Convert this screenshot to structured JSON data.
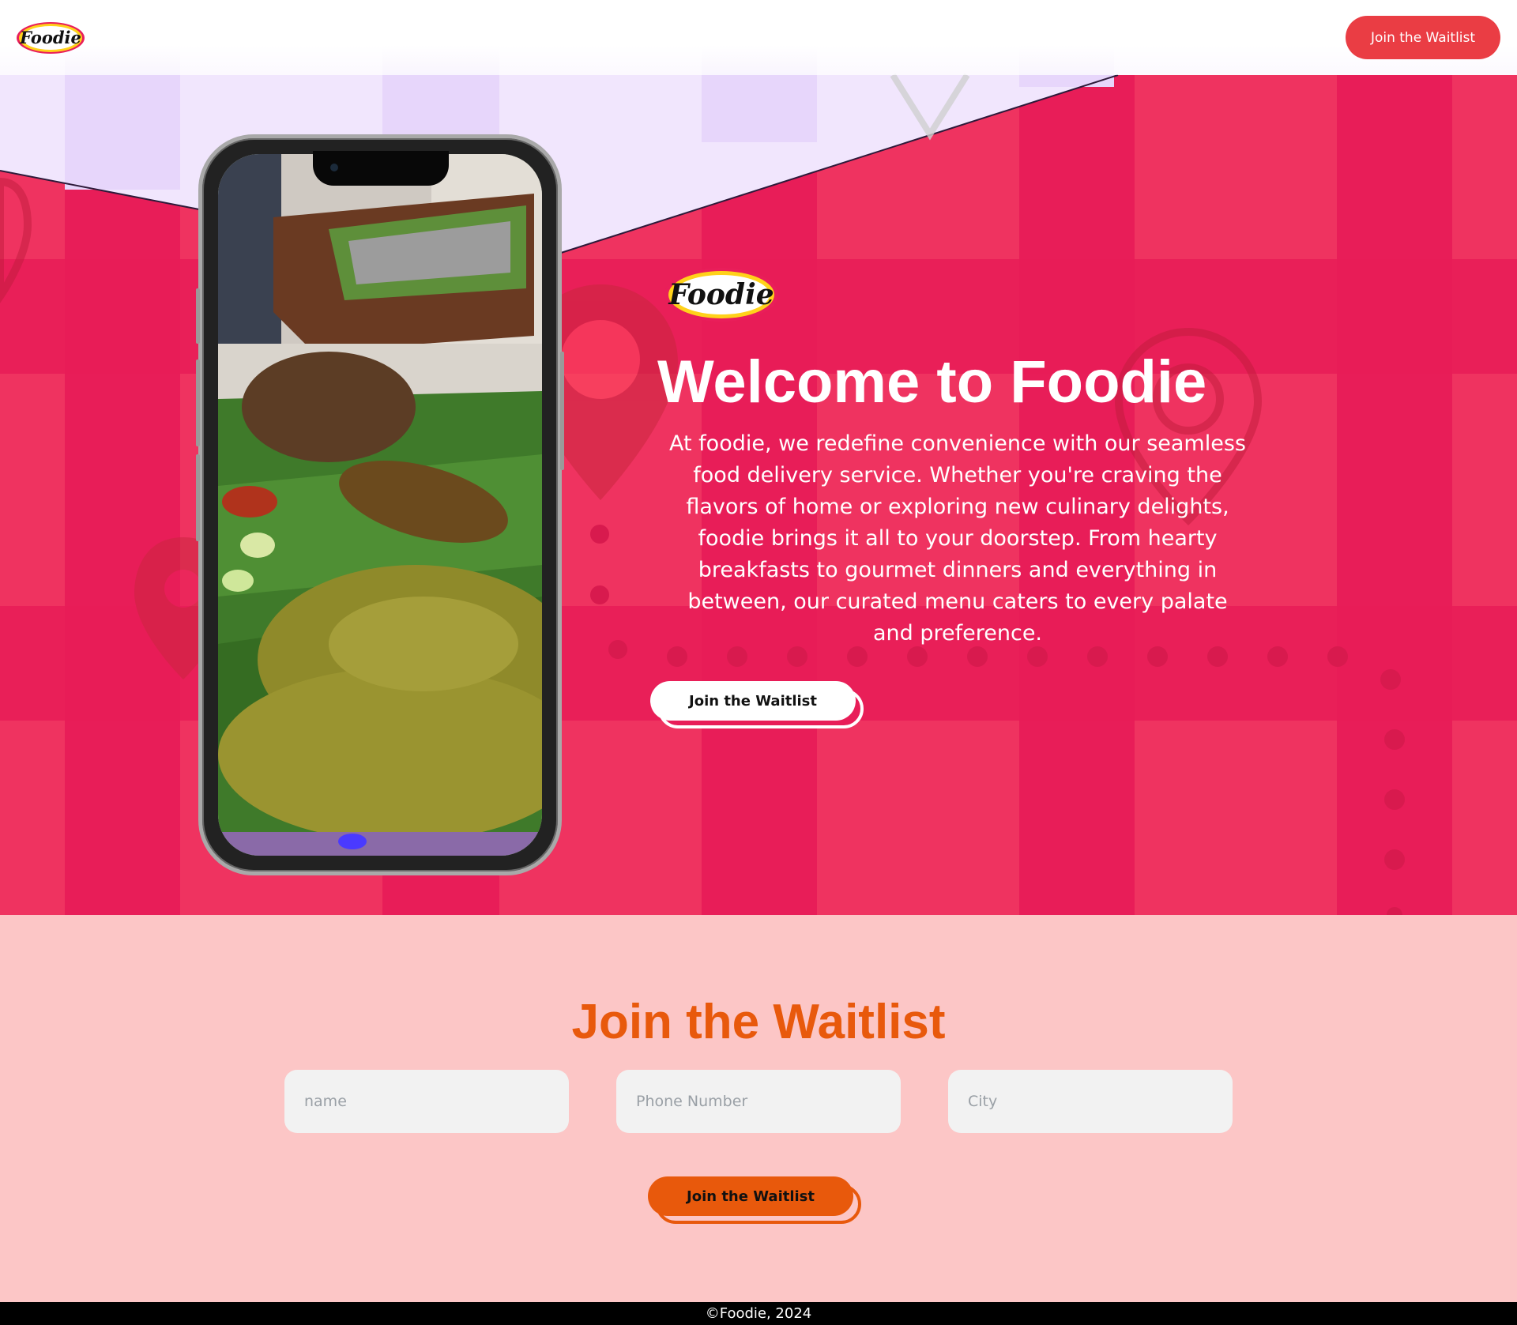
{
  "header": {
    "logo_text": "Foodie",
    "cta_label": "Join the Waitlist"
  },
  "hero": {
    "logo_text": "Foodie",
    "title": "Welcome to Foodie",
    "description": "At foodie, we redefine convenience with our seamless food delivery service. Whether you're craving the flavors of home or exploring new culinary delights, foodie brings it all to your doorstep. From hearty breakfasts to gourmet dinners and everything in between, our curated menu caters to every palate and preference.",
    "cta_label": "Join the Waitlist"
  },
  "waitlist": {
    "title": "Join the Waitlist",
    "name_placeholder": "name",
    "phone_placeholder": "Phone Number",
    "city_placeholder": "City",
    "submit_label": "Join the Waitlist"
  },
  "footer": {
    "copyright": "©Foodie, 2024"
  },
  "colors": {
    "hero_pink": "#e91e5a",
    "hero_pink_light": "#ef2e5c",
    "lavender": "#f1e6fd",
    "header_button": "#ea3d44",
    "waitlist_bg": "#fcc6c6",
    "waitlist_orange": "#e8590c",
    "footer_bg": "#000000"
  }
}
